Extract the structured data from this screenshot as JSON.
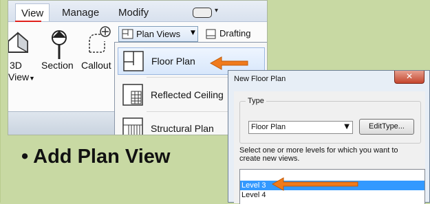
{
  "ribbon": {
    "tabs": [
      "View",
      "Manage",
      "Modify"
    ],
    "tools": {
      "view3d_line1": "3D",
      "view3d_line2": "View",
      "section": "Section",
      "callout": "Callout"
    },
    "plan_views_button": "Plan Views",
    "drafting_label": "Drafting",
    "menu_items": [
      "Floor Plan",
      "Reflected Ceiling",
      "Structural Plan"
    ]
  },
  "bullet": {
    "marker": "•",
    "text": "Add Plan View"
  },
  "dialog": {
    "title": "New Floor Plan",
    "close_glyph": "✕",
    "type_group_label": "Type",
    "type_value": "Floor Plan",
    "edit_type_button": "EditType...",
    "description": "Select one or more levels for which you want to create new views.",
    "levels": [
      "Level 3",
      "Level 4"
    ],
    "selected_level": "Level 3"
  },
  "colors": {
    "slide_background": "#c8d9a3",
    "active_tab_underline": "#e0201b",
    "callout_arrow": "#f07a1c",
    "selection": "#3399ff"
  }
}
